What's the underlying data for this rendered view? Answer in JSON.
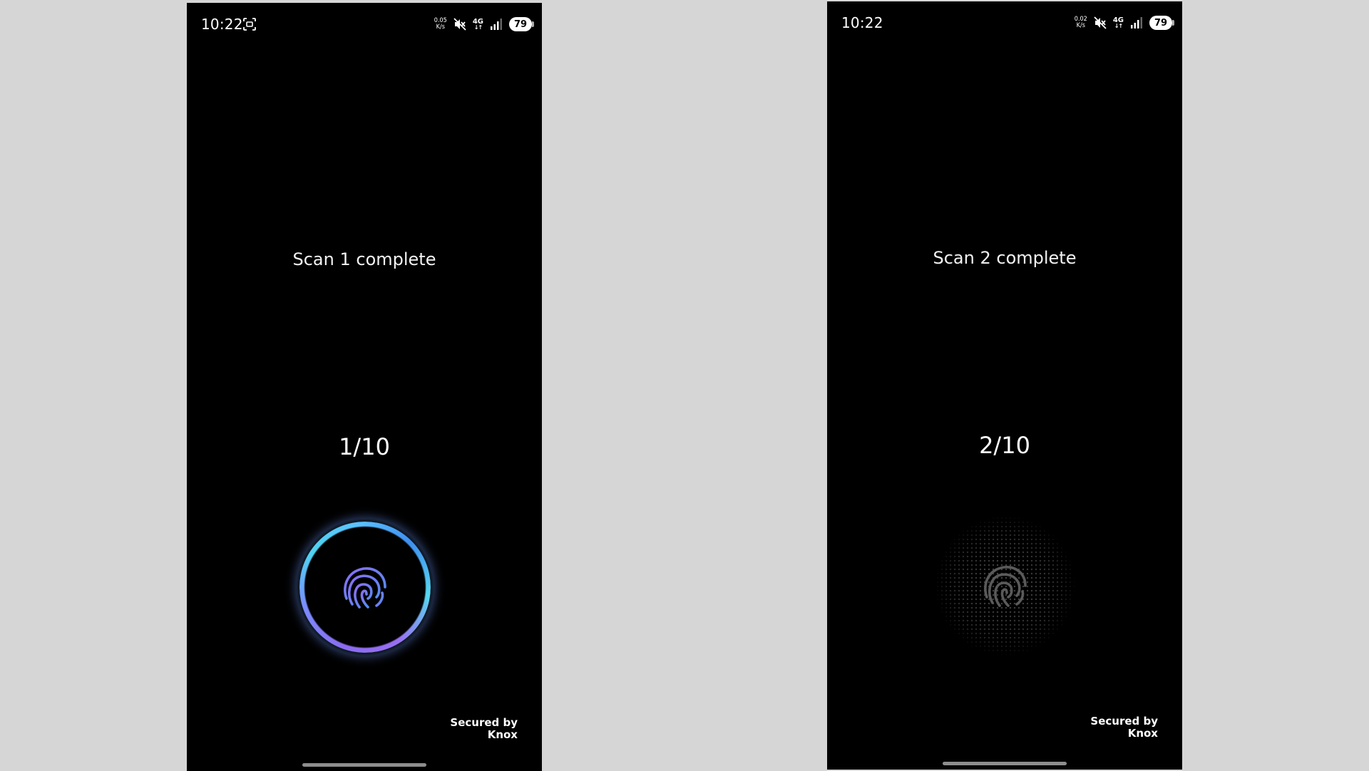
{
  "screens": [
    {
      "status_bar": {
        "time": "10:22",
        "net_speed_value": "0.05",
        "net_speed_unit": "K/s",
        "network_type": "4G",
        "battery": "79",
        "screenshot_icon": "screenshot-icon",
        "mute_icon": "mute-icon",
        "signal_icon": "signal-bars-icon"
      },
      "scan_message": "Scan 1 complete",
      "scan_progress": "1/10",
      "sensor_state": "active",
      "knox_line1": "Secured by",
      "knox_line2": "Knox"
    },
    {
      "status_bar": {
        "time": "10:22",
        "net_speed_value": "0.02",
        "net_speed_unit": "K/s",
        "network_type": "4G",
        "battery": "79",
        "mute_icon": "mute-icon",
        "signal_icon": "signal-bars-icon"
      },
      "scan_message": "Scan 2 complete",
      "scan_progress": "2/10",
      "sensor_state": "idle",
      "knox_line1": "Secured by",
      "knox_line2": "Knox"
    }
  ],
  "colors": {
    "ring_accent_purple": "#8a6cf0",
    "ring_accent_cyan": "#4fd4f0",
    "fingerprint_active": "#6f7ff0",
    "fingerprint_idle": "#5a5a5a"
  }
}
